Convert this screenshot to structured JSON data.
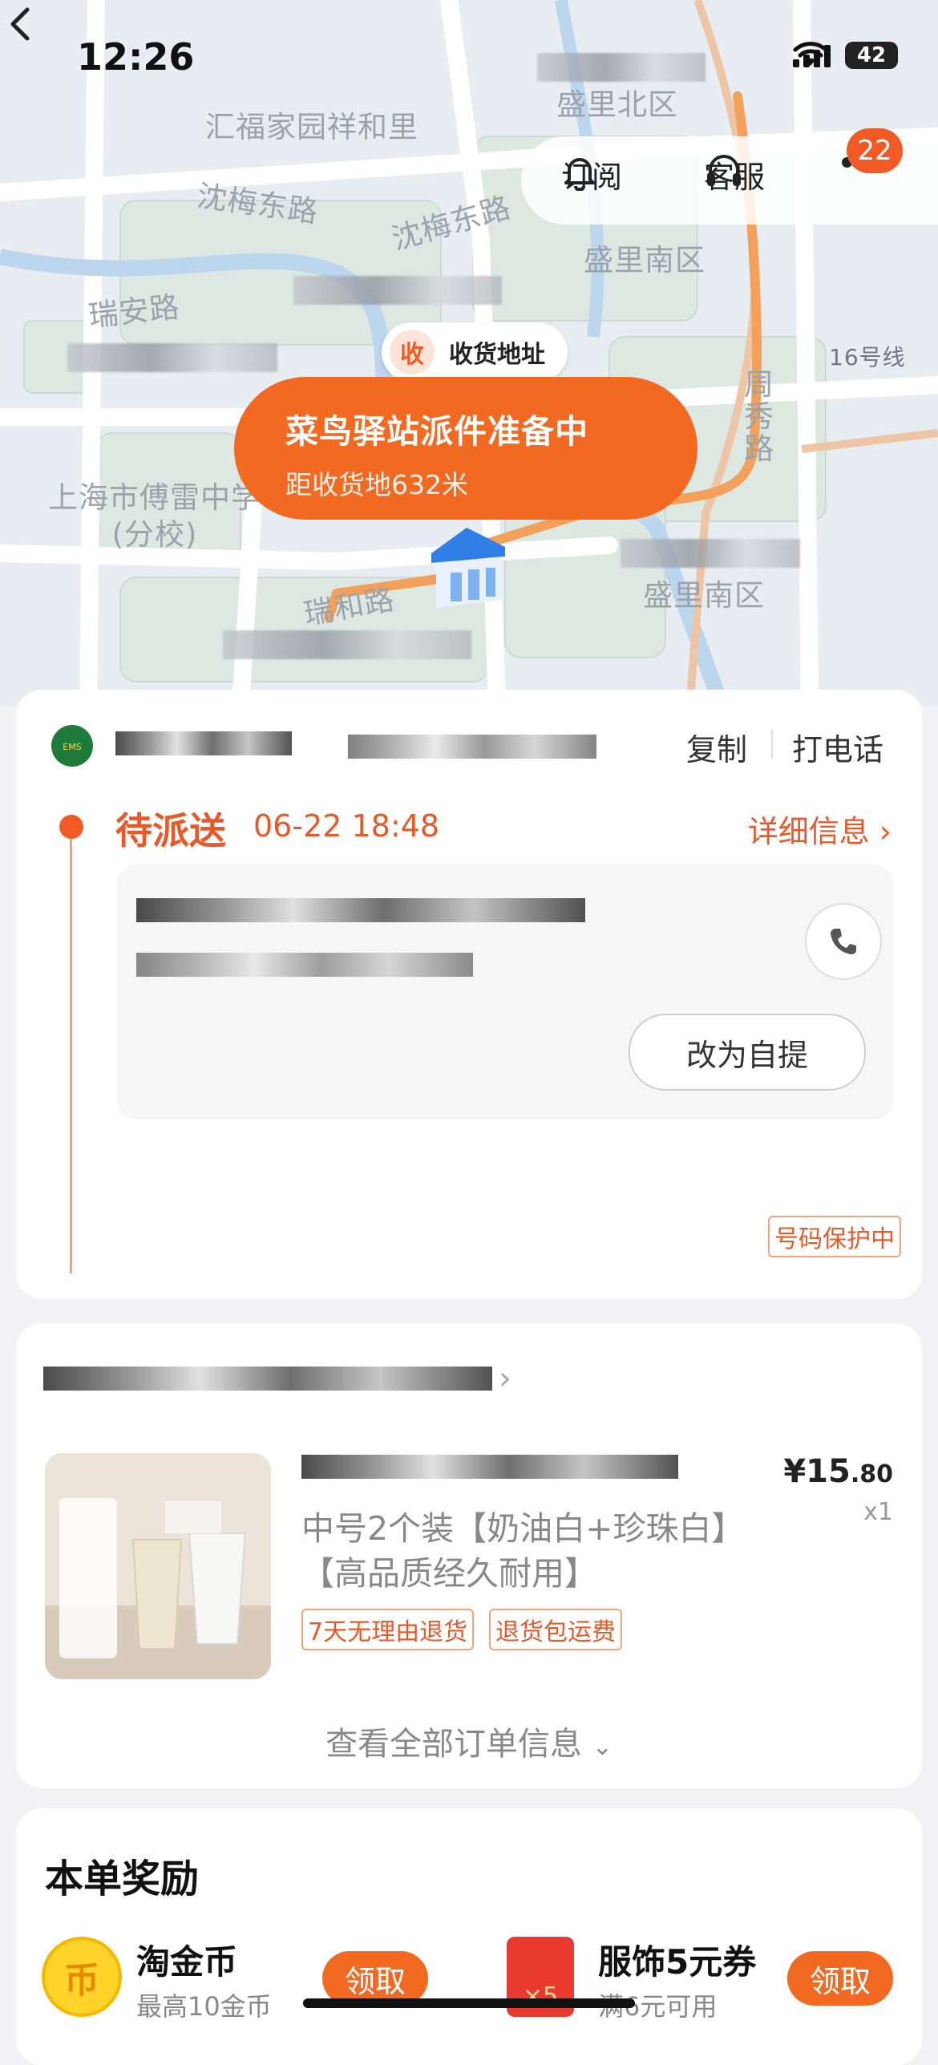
{
  "status_bar": {
    "time": "12:26",
    "battery": "42"
  },
  "header": {
    "subscribe_label": "订阅",
    "service_label": "客服",
    "notification_count": "22"
  },
  "map": {
    "labels": [
      "汇福家园祥和里",
      "盛里北区",
      "沈梅东路",
      "沈梅东路",
      "盛里南区",
      "瑞安路",
      "16号线",
      "周秀路",
      "上海市傅雷中学(分校)",
      "瑞和路",
      "盛里南区"
    ],
    "address_chip": {
      "icon_text": "收",
      "label": "收货地址"
    },
    "callout": {
      "title": "菜鸟驿站派件准备中",
      "subtitle": "距收货地632米"
    }
  },
  "tracking": {
    "copy_label": "复制",
    "call_label": "打电话",
    "status": "待派送",
    "status_time": "06-22 18:48",
    "detail_label": "详细信息",
    "self_pickup_label": "改为自提",
    "number_protect_label": "号码保护中"
  },
  "order": {
    "product_title": "中号2个装【奶油白+珍珠白】【高品质经久耐用】",
    "price_main": "¥15",
    "price_decimal": ".80",
    "quantity": "x1",
    "tags": [
      "7天无理由退货",
      "退货包运费"
    ],
    "view_all_label": "查看全部订单信息"
  },
  "rewards": {
    "title": "本单奖励",
    "items": [
      {
        "name": "淘金币",
        "sub": "最高10金币",
        "button": "领取",
        "icon_text": "币"
      },
      {
        "name": "服饰5元券",
        "sub": "满6元可用",
        "button": "领取",
        "icon_text": "×5"
      }
    ]
  },
  "colors": {
    "accent": "#f26a22",
    "status_text": "#e8592a"
  }
}
